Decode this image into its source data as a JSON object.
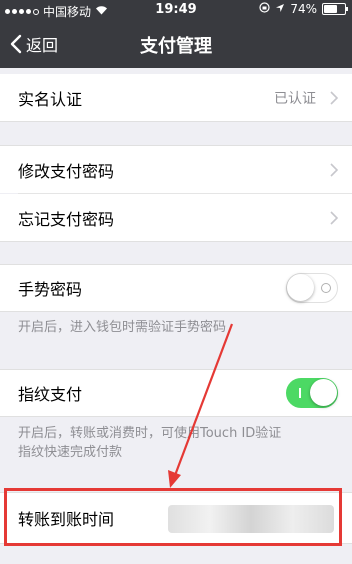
{
  "status_bar": {
    "carrier": "中国移动",
    "time": "19:49",
    "battery": "74%",
    "battery_level": 0.74,
    "wifi_icon": "wifi-icon",
    "lock_icon": "rotation-lock-icon",
    "location_icon": "location-arrow-icon"
  },
  "nav": {
    "back_label": "返回",
    "title": "支付管理"
  },
  "rows": {
    "real_name": {
      "label": "实名认证",
      "value": "已认证"
    },
    "change_pwd": {
      "label": "修改支付密码"
    },
    "forgot_pwd": {
      "label": "忘记支付密码"
    },
    "gesture": {
      "label": "手势密码",
      "enabled": false
    },
    "fingerprint": {
      "label": "指纹支付",
      "enabled": true
    },
    "transfer_time": {
      "label": "转账到账时间"
    }
  },
  "notes": {
    "gesture_note": "开启后，进入钱包时需验证手势密码",
    "fingerprint_note_line1": "开启后，转账或消费时，可使用Touch ID验证",
    "fingerprint_note_line2": "指纹快速完成付款"
  },
  "colors": {
    "nav_background": "#393a3f",
    "page_background": "#efeff4",
    "toggle_on": "#4cd964",
    "annotation_red": "#e53935"
  }
}
